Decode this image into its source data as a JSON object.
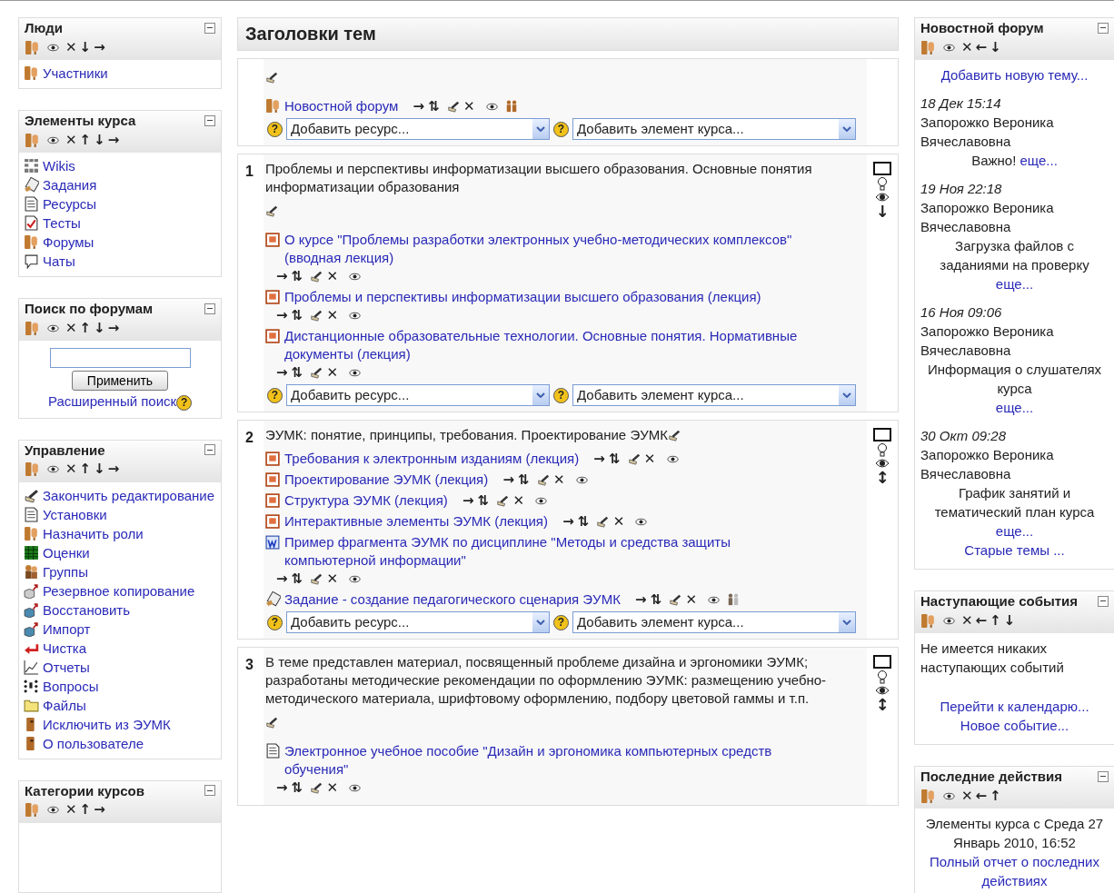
{
  "left_blocks": [
    {
      "title": "Люди",
      "controls": [
        "✕",
        "↓",
        "→"
      ],
      "kind": "links",
      "items": [
        {
          "kind": "people",
          "text": "Участники"
        }
      ]
    },
    {
      "title": "Элементы курса",
      "controls": [
        "✕",
        "↑",
        "↓",
        "→"
      ],
      "kind": "links",
      "items": [
        {
          "kind": "wiki",
          "text": "Wikis"
        },
        {
          "kind": "assignment",
          "text": "Задания"
        },
        {
          "kind": "resource",
          "text": "Ресурсы"
        },
        {
          "kind": "quiz",
          "text": "Тесты"
        },
        {
          "kind": "forum",
          "text": "Форумы"
        },
        {
          "kind": "chat",
          "text": "Чаты"
        }
      ]
    },
    {
      "title": "Поиск по форумам",
      "controls": [
        "✕",
        "↑",
        "↓",
        "→"
      ],
      "kind": "search",
      "button": "Применить",
      "link": "Расширенный поиск",
      "help": "?"
    },
    {
      "title": "Управление",
      "controls": [
        "✕",
        "↑",
        "↓",
        "→"
      ],
      "kind": "links",
      "items": [
        {
          "kind": "edit",
          "text": "Закончить редактирование"
        },
        {
          "kind": "settings",
          "text": "Установки"
        },
        {
          "kind": "roles",
          "text": "Назначить роли"
        },
        {
          "kind": "grades",
          "text": "Оценки"
        },
        {
          "kind": "groups",
          "text": "Группы"
        },
        {
          "kind": "backup",
          "text": "Резервное копирование"
        },
        {
          "kind": "restore",
          "text": "Восстановить"
        },
        {
          "kind": "import",
          "text": "Импорт"
        },
        {
          "kind": "reset",
          "text": "Чистка"
        },
        {
          "kind": "reports",
          "text": "Отчеты"
        },
        {
          "kind": "questions",
          "text": "Вопросы"
        },
        {
          "kind": "files",
          "text": "Файлы"
        },
        {
          "kind": "person",
          "text": "Исключить из ЭУМК"
        },
        {
          "kind": "person",
          "text": "О пользователе"
        }
      ]
    },
    {
      "title": "Категории курсов",
      "controls": [
        "✕",
        "↑",
        "→"
      ],
      "kind": "links"
    }
  ],
  "main": {
    "heading": "Заголовки тем",
    "sections": [
      {
        "kind": "stacked",
        "activities": [
          {
            "kind": "forum",
            "text": "Новостной форум",
            "moves": [
              "→",
              "⇅"
            ],
            "delete": "✕",
            "groups_on": true
          }
        ],
        "add": {
          "help": "?",
          "resource": "Добавить ресурс...",
          "activity": "Добавить элемент курса..."
        }
      },
      {
        "kind": "stacked",
        "number": "1",
        "summary": "Проблемы и перспективы информатизации высшего образования. Основные понятия информатизации образования",
        "move": "↓",
        "activities": [
          {
            "kind": "ppt",
            "text": "О курсе \"Проблемы разработки электронных учебно-методических комплексов\" (вводная лекция)",
            "moves": [
              "→",
              "⇅"
            ],
            "delete": "✕"
          },
          {
            "kind": "ppt",
            "text": "Проблемы и перспективы информатизации высшего образования (лекция)",
            "moves": [
              "→",
              "⇅"
            ],
            "delete": "✕"
          },
          {
            "kind": "ppt",
            "text": "Дистанционные образовательные технологии. Основные понятия. Нормативные документы (лекция)",
            "moves": [
              "→",
              "⇅"
            ],
            "delete": "✕"
          }
        ],
        "add": {
          "help": "?",
          "resource": "Добавить ресурс...",
          "activity": "Добавить элемент курса..."
        }
      },
      {
        "kind": "inline",
        "number": "2",
        "summary": "ЭУМК: понятие, принципы, требования. Проектирование ЭУМК",
        "move": "↕",
        "activities": [
          {
            "kind": "ppt",
            "text": "Требования к электронным изданиям (лекция)",
            "moves": [
              "→",
              "⇅"
            ],
            "delete": "✕"
          },
          {
            "kind": "ppt",
            "text": "Проектирование ЭУМК (лекция)",
            "moves": [
              "→",
              "⇅"
            ],
            "delete": "✕"
          },
          {
            "kind": "ppt",
            "text": "Структура ЭУМК (лекция)",
            "moves": [
              "→",
              "⇅"
            ],
            "delete": "✕"
          },
          {
            "kind": "ppt",
            "text": "Интерактивные элементы ЭУМК (лекция)",
            "moves": [
              "→",
              "⇅"
            ],
            "delete": "✕"
          },
          {
            "kind": "word",
            "text": "Пример фрагмента ЭУМК по дисциплине \"Методы и средства защиты компьютерной информации\"",
            "moves": [
              "→",
              "⇅"
            ],
            "delete": "✕"
          },
          {
            "kind": "assignment",
            "text": "Задание - создание педагогического сценария ЭУМК",
            "moves": [
              "→",
              "⇅"
            ],
            "delete": "✕",
            "groups_on": false
          }
        ],
        "add": {
          "help": "?",
          "resource": "Добавить ресурс...",
          "activity": "Добавить элемент курса..."
        }
      },
      {
        "kind": "stacked",
        "number": "3",
        "summary": "В теме представлен материал, посвященный проблеме дизайна и эргономики ЭУМК; разработаны методические рекомендации по оформлению ЭУМК: размещению учебно-методического материала, шрифтовому оформлению, подбору цветовой гаммы и т.п.",
        "move": "↕",
        "activities": [
          {
            "kind": "page",
            "text": "Электронное учебное пособие \"Дизайн и эргономика компьютерных средств обучения\"",
            "moves": [
              "→",
              "⇅"
            ],
            "delete": "✕"
          }
        ]
      }
    ]
  },
  "right_blocks": [
    {
      "title": "Новостной форум",
      "controls": [
        "✕",
        "←",
        "↓"
      ],
      "kind": "news",
      "add_link": "Добавить новую тему...",
      "posts": [
        {
          "date": "18 Дек 15:14",
          "author": "Запорожко Вероника Вячеславовна",
          "subject": "Важно!",
          "more": "еще..."
        },
        {
          "date": "19 Ноя 22:18",
          "author": "Запорожко Вероника Вячеславовна",
          "subject": "Загрузка файлов с заданиями на проверку",
          "more": "еще..."
        },
        {
          "date": "16 Ноя 09:06",
          "author": "Запорожко Вероника Вячеславовна",
          "subject": "Информация о слушателях курса",
          "more": "еще..."
        },
        {
          "date": "30 Окт 09:28",
          "author": "Запорожко Вероника Вячеславовна",
          "subject": "График занятий и тематический план курса",
          "more": "еще..."
        }
      ],
      "older": "Старые темы ..."
    },
    {
      "title": "Наступающие события",
      "controls": [
        "✕",
        "←",
        "↑",
        "↓"
      ],
      "kind": "events",
      "text": "Не имеется никаких наступающих событий",
      "links": [
        "Перейти к календарю...",
        "Новое событие..."
      ]
    },
    {
      "title": "Последние действия",
      "controls": [
        "✕",
        "←",
        "↑"
      ],
      "kind": "recent",
      "text": "Элементы курса с Среда 27 Январь 2010, 16:52",
      "links": [
        "Полный отчет о последних действиях"
      ]
    }
  ]
}
